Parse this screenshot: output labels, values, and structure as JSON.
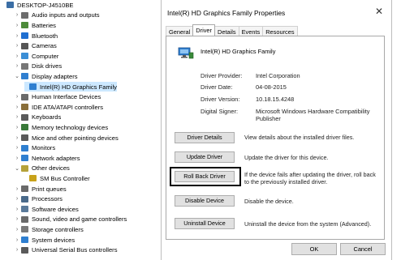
{
  "tree": {
    "items": [
      {
        "label": "DESKTOP-J4510BE",
        "chev": "",
        "icon": "computer-icon",
        "color": "#3b6ea5",
        "child": false
      },
      {
        "label": "Audio inputs and outputs",
        "chev": "›",
        "icon": "speaker-icon",
        "color": "#6d6d6d",
        "child": false
      },
      {
        "label": "Batteries",
        "chev": "›",
        "icon": "battery-icon",
        "color": "#4d8b3a",
        "child": false
      },
      {
        "label": "Bluetooth",
        "chev": "›",
        "icon": "bluetooth-icon",
        "color": "#1f6fd1",
        "child": false
      },
      {
        "label": "Cameras",
        "chev": "›",
        "icon": "camera-icon",
        "color": "#555555",
        "child": false
      },
      {
        "label": "Computer",
        "chev": "›",
        "icon": "computer-icon",
        "color": "#3b8ed6",
        "child": false
      },
      {
        "label": "Disk drives",
        "chev": "›",
        "icon": "disk-icon",
        "color": "#777777",
        "child": false
      },
      {
        "label": "Display adapters",
        "chev": "⌄",
        "icon": "display-icon",
        "color": "#2f7fd0",
        "child": false
      },
      {
        "label": "Intel(R) HD Graphics Family",
        "chev": "",
        "icon": "display-icon",
        "color": "#2f7fd0",
        "child": true,
        "selected": true
      },
      {
        "label": "Human Interface Devices",
        "chev": "›",
        "icon": "hid-icon",
        "color": "#6a6a6a",
        "child": false
      },
      {
        "label": "IDE ATA/ATAPI controllers",
        "chev": "›",
        "icon": "controller-icon",
        "color": "#8a6f3a",
        "child": false
      },
      {
        "label": "Keyboards",
        "chev": "›",
        "icon": "keyboard-icon",
        "color": "#5a5a5a",
        "child": false
      },
      {
        "label": "Memory technology devices",
        "chev": "›",
        "icon": "memory-icon",
        "color": "#3a7a3a",
        "child": false
      },
      {
        "label": "Mice and other pointing devices",
        "chev": "›",
        "icon": "mouse-icon",
        "color": "#5a5a5a",
        "child": false
      },
      {
        "label": "Monitors",
        "chev": "›",
        "icon": "monitor-icon",
        "color": "#2f7fd0",
        "child": false
      },
      {
        "label": "Network adapters",
        "chev": "›",
        "icon": "network-icon",
        "color": "#2f7fd0",
        "child": false
      },
      {
        "label": "Other devices",
        "chev": "⌄",
        "icon": "unknown-device-icon",
        "color": "#b5a23a",
        "child": false
      },
      {
        "label": "SM Bus Controller",
        "chev": "",
        "icon": "warning-device-icon",
        "color": "#c8a21a",
        "child": true
      },
      {
        "label": "Print queues",
        "chev": "›",
        "icon": "printer-icon",
        "color": "#6a6a6a",
        "child": false
      },
      {
        "label": "Processors",
        "chev": "›",
        "icon": "processor-icon",
        "color": "#4a6a8a",
        "child": false
      },
      {
        "label": "Software devices",
        "chev": "›",
        "icon": "software-icon",
        "color": "#5a7a9a",
        "child": false
      },
      {
        "label": "Sound, video and game controllers",
        "chev": "›",
        "icon": "sound-icon",
        "color": "#6a6a6a",
        "child": false
      },
      {
        "label": "Storage controllers",
        "chev": "›",
        "icon": "storage-icon",
        "color": "#7a7a7a",
        "child": false
      },
      {
        "label": "System devices",
        "chev": "›",
        "icon": "system-icon",
        "color": "#2f7fd0",
        "child": false
      },
      {
        "label": "Universal Serial Bus controllers",
        "chev": "›",
        "icon": "usb-icon",
        "color": "#5a5a5a",
        "child": false
      }
    ]
  },
  "dialog": {
    "title": "Intel(R) HD Graphics Family Properties",
    "close": "✕",
    "tabs": [
      "General",
      "Driver",
      "Details",
      "Events",
      "Resources"
    ],
    "active_tab": "Driver",
    "device_name": "Intel(R) HD Graphics Family",
    "info": {
      "provider_label": "Driver Provider:",
      "provider": "Intel Corporation",
      "date_label": "Driver Date:",
      "date": "04-08-2015",
      "version_label": "Driver Version:",
      "version": "10.18.15.4248",
      "signer_label": "Digital Signer:",
      "signer": "Microsoft Windows Hardware Compatibility Publisher"
    },
    "buttons": {
      "details": {
        "label": "Driver Details",
        "desc": "View details about the installed driver files."
      },
      "update": {
        "label": "Update Driver",
        "desc": "Update the driver for this device."
      },
      "rollback": {
        "label": "Roll Back Driver",
        "desc": "If the device fails after updating the driver, roll back to the previously installed driver."
      },
      "disable": {
        "label": "Disable Device",
        "desc": "Disable the device."
      },
      "uninstall": {
        "label": "Uninstall Device",
        "desc": "Uninstall the device from the system (Advanced)."
      }
    },
    "ok": "OK",
    "cancel": "Cancel"
  },
  "colors": {
    "highlight": "#000000",
    "selection": "#cce8ff",
    "button_face": "#e1e1e1"
  }
}
